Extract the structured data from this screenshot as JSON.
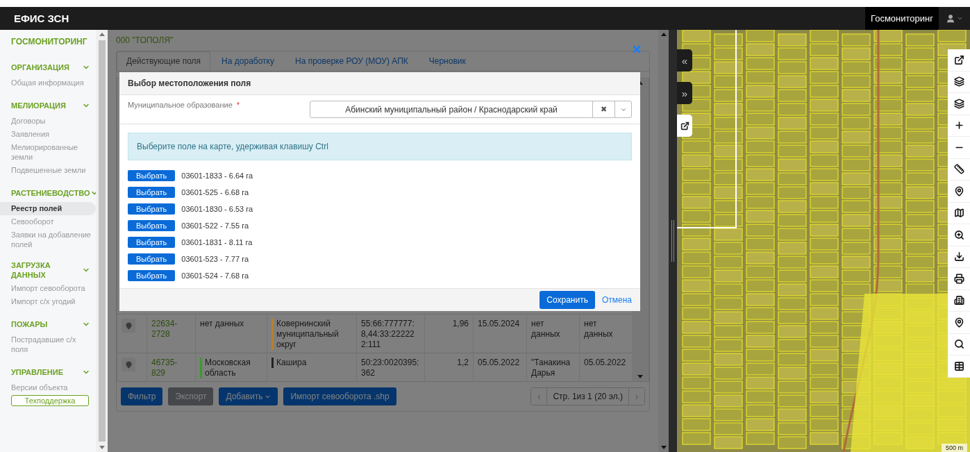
{
  "app": {
    "title": "ЕФИС ЗСН",
    "user": "Госмониторинг"
  },
  "sidebar": {
    "title": "ГОСМОНИТОРИНГ",
    "sections": [
      {
        "title": "ОРГАНИЗАЦИЯ",
        "expanded": true,
        "items": [
          {
            "label": "Общая информация",
            "selected": false
          }
        ]
      },
      {
        "title": "МЕЛИОРАЦИЯ",
        "expanded": true,
        "items": [
          {
            "label": "Договоры",
            "selected": false
          },
          {
            "label": "Заявления",
            "selected": false
          },
          {
            "label": "Мелиорированные земли",
            "selected": false
          },
          {
            "label": "Подвешенные земли",
            "selected": false
          }
        ]
      },
      {
        "title": "РАСТЕНИЕВОДСТВО",
        "expanded": true,
        "items": [
          {
            "label": "Реестр полей",
            "selected": true
          },
          {
            "label": "Севооборот",
            "selected": false
          },
          {
            "label": "Заявки на добавление полей",
            "selected": false
          }
        ]
      },
      {
        "title": "ЗАГРУЗКА ДАННЫХ",
        "expanded": true,
        "items": [
          {
            "label": "Импорт севооборота",
            "selected": false
          },
          {
            "label": "Импорт  с/х угодий",
            "selected": false
          }
        ]
      },
      {
        "title": "ПОЖАРЫ",
        "expanded": true,
        "items": [
          {
            "label": "Пострадавшие с/х поля",
            "selected": false
          }
        ]
      },
      {
        "title": "УПРАВЛЕНИЕ",
        "expanded": true,
        "items": [
          {
            "label": "Версии объекта",
            "selected": false
          }
        ]
      }
    ],
    "support_button": "Техподдержка"
  },
  "content": {
    "organization": "000 \"ТОПОЛЯ\"",
    "tabs": [
      {
        "label": "Действующие поля",
        "selected": true
      },
      {
        "label": "На доработку",
        "selected": false
      },
      {
        "label": "На проверке РОУ (МОУ) АПК",
        "selected": false
      },
      {
        "label": "Черновик",
        "selected": false
      }
    ],
    "rows": [
      {
        "cells": [
          {
            "text": "22634-2728"
          },
          {
            "text": "нет данных"
          },
          {
            "text": "Ковернинский муниципальный округ",
            "color": "#b8802c"
          },
          {
            "text": "55:66:777777:8,44:33:222222:111"
          },
          {
            "text": "1,96"
          },
          {
            "text": "15.05.2024"
          },
          {
            "text": "нет данных"
          },
          {
            "text": "нет данных"
          }
        ]
      },
      {
        "cells": [
          {
            "text": "46735-829"
          },
          {
            "text": "Московская область",
            "color": "#3c9a2c"
          },
          {
            "text": "Кашира",
            "color": "#222222"
          },
          {
            "text": "50:23:0020395:362"
          },
          {
            "text": "1,2"
          },
          {
            "text": "05.05.2022"
          },
          {
            "text": "\"Танакина Дарья"
          },
          {
            "text": "05.05.2022"
          }
        ]
      }
    ],
    "buttons": [
      {
        "label": "Фильтр",
        "kind": "primary"
      },
      {
        "label": "Экспорт",
        "kind": "disabled"
      },
      {
        "label": "Добавить",
        "kind": "dropdown"
      },
      {
        "label": "Импорт севооборота .shp",
        "kind": "primary"
      }
    ],
    "pager": {
      "prev": "‹",
      "page": "Стр. 1из 1 (20 эл.)",
      "next": "›"
    }
  },
  "modal": {
    "title": "Выбор местоположения поля",
    "field_label": "Муниципальное образование",
    "required_mark": "*",
    "field_value": "Абинский муниципальный район / Краснодарский край",
    "clear": "✖",
    "hint": "Выберите поле на карте, удерживая клавишу Ctrl",
    "fields": [
      {
        "button": "Выбрать",
        "label": "03601-1833 - 6.64 га"
      },
      {
        "button": "Выбрать",
        "label": "03601-525 - 6.68 га"
      },
      {
        "button": "Выбрать",
        "label": "03601-1830 - 6.53 га"
      },
      {
        "button": "Выбрать",
        "label": "03601-522 - 7.55 га"
      },
      {
        "button": "Выбрать",
        "label": "03601-1831 - 8.11 га"
      },
      {
        "button": "Выбрать",
        "label": "03601-523 - 7.77 га"
      },
      {
        "button": "Выбрать",
        "label": "03601-524 - 7.68 га"
      }
    ],
    "save": "Сохранить",
    "cancel": "Отмена"
  },
  "map": {
    "collapse": "«",
    "expand": "»",
    "scale": "500 m"
  }
}
